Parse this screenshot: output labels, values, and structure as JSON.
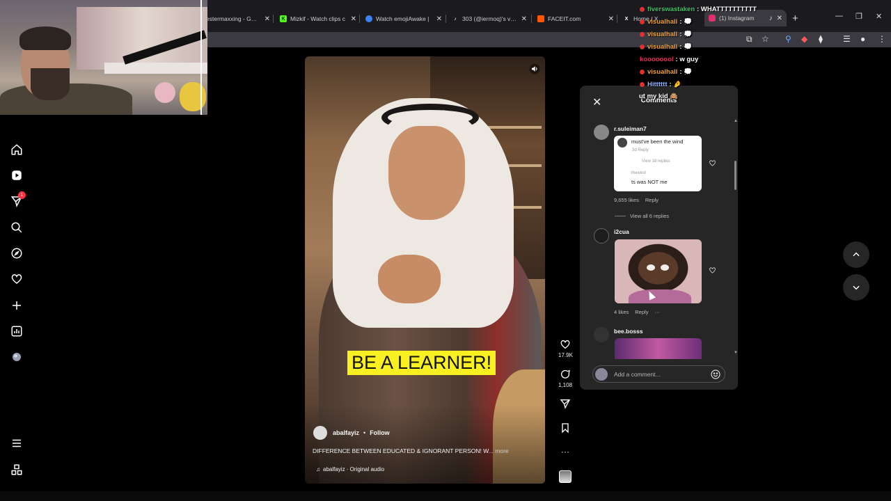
{
  "browser": {
    "tabs": [
      {
        "title": "estermaxxing - Goog",
        "fav": "G",
        "color": "#4285f4"
      },
      {
        "title": "Mizkif - Watch clips c",
        "fav": "K",
        "color": "#53fc18"
      },
      {
        "title": "Watch emojiAwake |",
        "fav": "",
        "color": "#3b82f6"
      },
      {
        "title": "303 (@iermoq)'s vide",
        "fav": "♪",
        "color": "#ffffff"
      },
      {
        "title": "FACEIT.com",
        "fav": "",
        "color": "#ff5500"
      },
      {
        "title": "Home / X",
        "fav": "X",
        "color": "#ffffff"
      },
      {
        "title": "(1) Instagram",
        "fav": "",
        "color": "#e1306c"
      }
    ],
    "close_glyph": "✕",
    "new_tab_glyph": "+"
  },
  "reel": {
    "caption": "BE A LEARNER!",
    "author": "abalfayiz",
    "follow": "Follow",
    "description": "DIFFERENCE BETWEEN EDUCATED & IGNORANT PERSON! W",
    "more": "... more",
    "audio": "abalfayiz · Original audio",
    "likes": "17.9K",
    "comments_count": "1,108"
  },
  "comments": {
    "title": "Comments",
    "items": [
      {
        "user": "r.suleiman7",
        "likes": "9,655 likes",
        "reply": "Reply",
        "view_replies": "View all 6 replies",
        "screenshot": {
          "line1": "must've been the wind",
          "line2": "3d   Reply",
          "line3": "View 18 replies",
          "line4": "thewind",
          "line5": "ts was NOT me"
        }
      },
      {
        "user": "i2cua",
        "likes": "4 likes",
        "reply": "Reply",
        "more": "···"
      },
      {
        "user": "bee.bosss"
      }
    ],
    "input_placeholder": "Add a comment..."
  },
  "chat": [
    {
      "user": "fiverswastaken",
      "color": "#3fbf6a",
      "msg": ": WHATTTTTTTTTT"
    },
    {
      "user": "visualhall",
      "color": "#f0a030",
      "msg": ": 💭"
    },
    {
      "user": "visualhall",
      "color": "#f0a030",
      "msg": ": 💭"
    },
    {
      "user": "visualhall",
      "color": "#f0a030",
      "msg": ": 💭"
    },
    {
      "user": "koooooool",
      "color": "#e0305a",
      "msg": ": w guy"
    },
    {
      "user": "visualhall",
      "color": "#f0a030",
      "msg": ": 💭"
    },
    {
      "user": "Hitttttt",
      "color": "#8fb4ff",
      "msg": ": 🤌"
    },
    {
      "user": "",
      "color": "#ffffff",
      "msg": "ut my kid 🙈"
    }
  ],
  "colors": {
    "accent": "#ff3040",
    "panel": "#262626",
    "caption_bg": "#f8f021"
  },
  "left_nav": {
    "items": [
      "home-icon",
      "reels-icon",
      "messages-icon",
      "search-icon",
      "explore-icon",
      "heart-icon",
      "create-icon",
      "insights-icon",
      "profile-avatar",
      "menu-icon",
      "threads-icon"
    ],
    "notification_count": "1"
  }
}
